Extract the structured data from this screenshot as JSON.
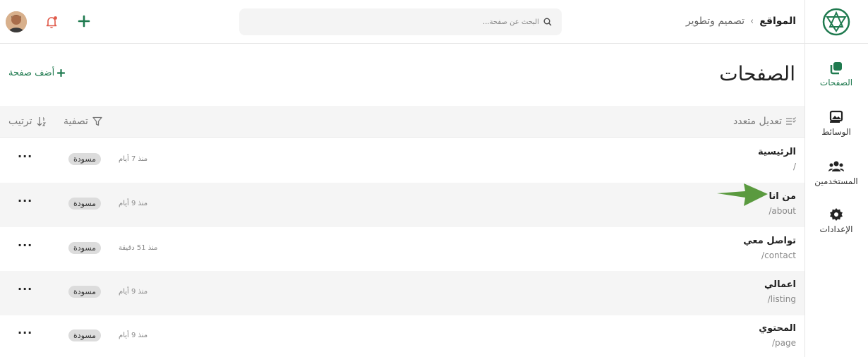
{
  "header": {
    "breadcrumb_root": "المواقع",
    "breadcrumb_separator": "›",
    "breadcrumb_current": "تصميم وتطوير",
    "search_placeholder": "البحث عن صفحة..."
  },
  "rail": {
    "items": [
      {
        "label": "الصفحات",
        "active": true
      },
      {
        "label": "الوسائط"
      },
      {
        "label": "المستخدمين"
      },
      {
        "label": "الإعدادات"
      }
    ]
  },
  "main": {
    "title": "الصفحات",
    "add_page": "أضف صفحة",
    "bulk_edit": "تعديل متعدد",
    "filter": "تصفية",
    "sort": "ترتيب"
  },
  "pages": [
    {
      "title": "الرئيسية",
      "slug": "/",
      "time": "منذ 7 أيام",
      "status": "مسودة",
      "menu": "···"
    },
    {
      "title": "من انا",
      "slug": "/about",
      "time": "منذ 9 أيام",
      "status": "مسودة",
      "menu": "···"
    },
    {
      "title": "تواصل معي",
      "slug": "/contact",
      "time": "منذ 51 دقيقة",
      "status": "مسودة",
      "menu": "···"
    },
    {
      "title": "اعمالي",
      "slug": "/listing",
      "time": "منذ 9 أيام",
      "status": "مسودة",
      "menu": "···"
    },
    {
      "title": "المحتوي",
      "slug": "/page",
      "time": "منذ 9 أيام",
      "status": "مسودة",
      "menu": "···"
    }
  ],
  "colors": {
    "accent": "#1f7a4f",
    "arrow": "#5a9a3f",
    "bell": "#e05a4a"
  }
}
